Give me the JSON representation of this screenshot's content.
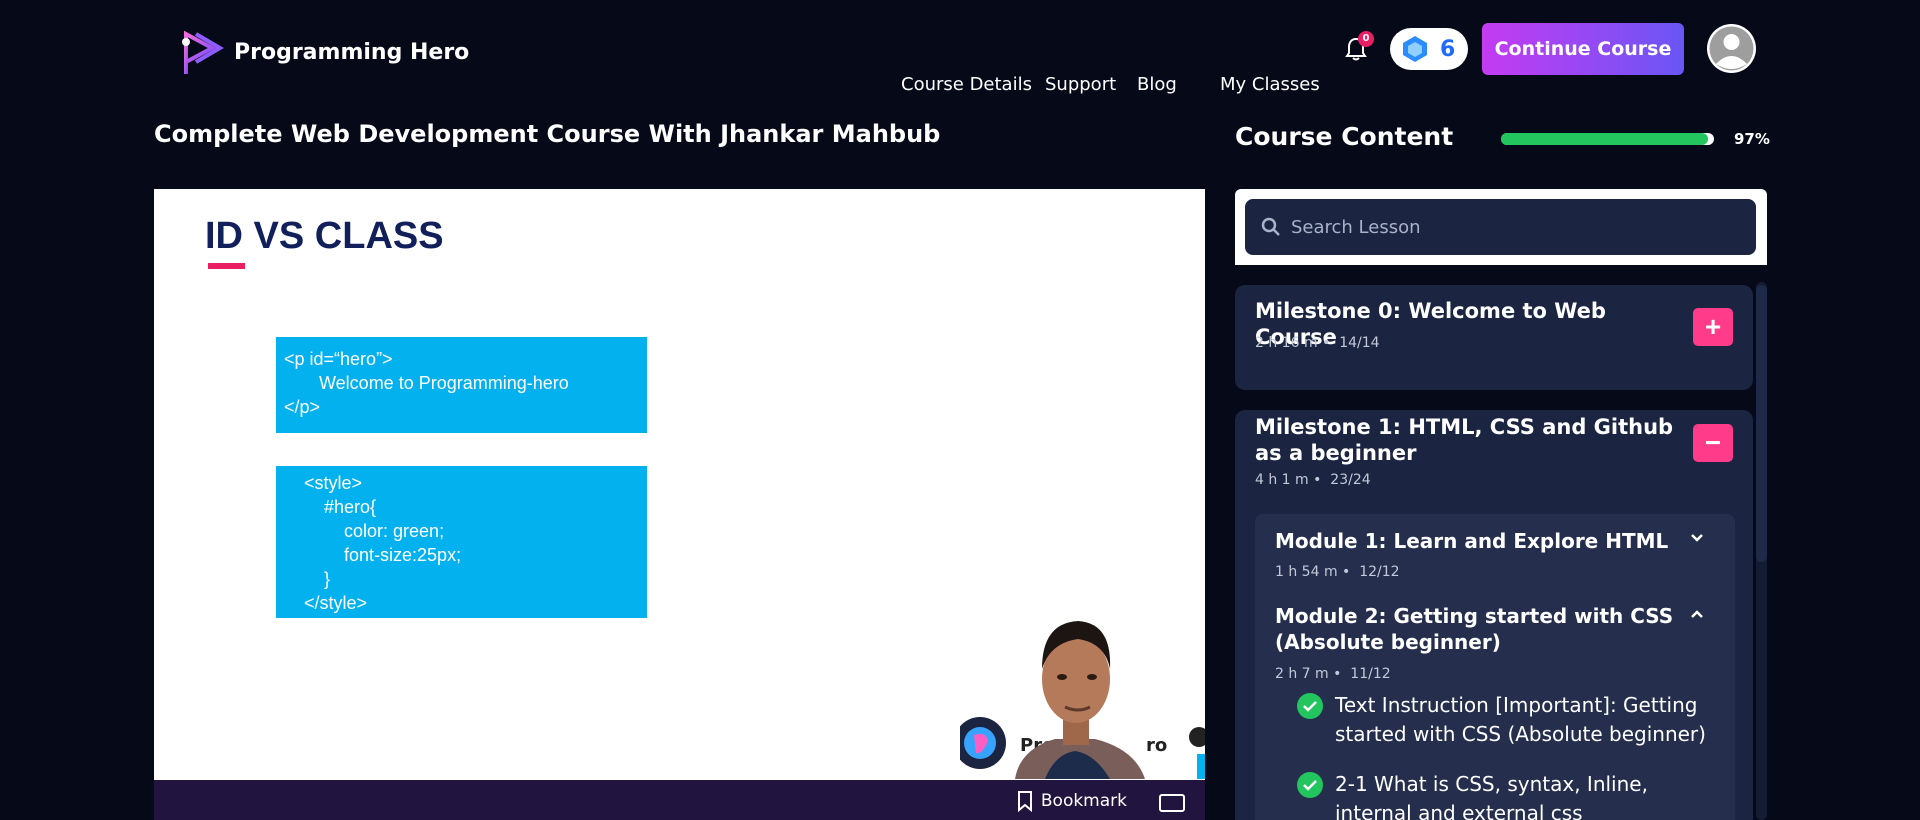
{
  "header": {
    "brand": "Programming Hero",
    "nav": [
      "Course Details",
      "Support",
      "Blog",
      "My Classes"
    ],
    "notification_count": "0",
    "gems_count": "6",
    "continue_label": "Continue Course"
  },
  "main": {
    "course_title": "Complete Web Development Course With Jhankar Mahbub",
    "slide": {
      "title": "ID VS CLASS",
      "code_box_1": [
        "<p id=“hero”>",
        "       Welcome to Programming-hero",
        "</p>"
      ],
      "code_box_2": [
        "    <style>",
        "        #hero{",
        "            color: green;",
        "            font-size:25px;",
        "        }",
        "    </style>"
      ],
      "watermark": "Programming Hero"
    },
    "bookmark_label": "Bookmark"
  },
  "sidebar": {
    "title": "Course Content",
    "progress_percent": 97,
    "progress_label": "97%",
    "search_placeholder": "Search Lesson",
    "milestones": [
      {
        "title": "Milestone 0: Welcome to Web Course",
        "duration": "2 h 16 m",
        "progress": "14/14",
        "state": "+"
      },
      {
        "title": "Milestone 1: HTML, CSS and Github as a beginner",
        "duration": "4 h 1 m",
        "progress": "23/24",
        "state": "−"
      }
    ],
    "modules": [
      {
        "title": "Module 1: Learn and Explore HTML",
        "duration": "1 h 54 m",
        "progress": "12/12"
      },
      {
        "title": "Module 2: Getting started with CSS (Absolute beginner)",
        "duration": "2 h 7 m",
        "progress": "11/12"
      }
    ],
    "lessons": [
      "Text Instruction [Important]: Getting started with CSS (Absolute beginner)",
      "2-1 What is CSS, syntax, Inline, internal and external css"
    ]
  },
  "colors": {
    "background": "#050918",
    "accent_pink": "#ff3b8a",
    "progress_green": "#22c55e",
    "panel": "#1b2440"
  }
}
